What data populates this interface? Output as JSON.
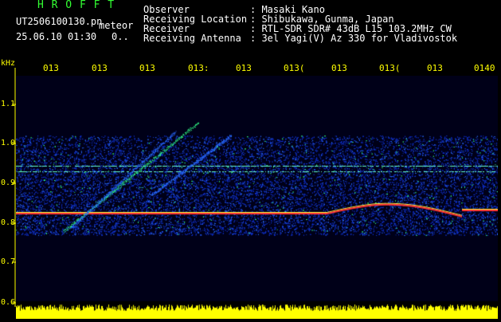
{
  "header": {
    "logo": "H R O F F T",
    "filename": "UT2506100130.pn",
    "type_label": "meteor",
    "datetime": "25.06.10 01:30",
    "extra": "0..",
    "fields": [
      {
        "label": "Observer",
        "value": ": Masaki Kano"
      },
      {
        "label": "Receiving Location",
        "value": ": Shibukawa, Gunma, Japan"
      },
      {
        "label": "Receiver",
        "value": ": RTL-SDR SDR# 43dB L15 103.2MHz CW"
      },
      {
        "label": "Receiving Antenna",
        "value": ": 3el Yagi(V) Az 330 for Vladivostok"
      }
    ]
  },
  "axis": {
    "unit": "kHz",
    "y_labels": [
      "1.1",
      "1.0",
      "0.9",
      "0.8",
      "0.7",
      "0.6"
    ],
    "x_labels": [
      "013",
      "013",
      "013",
      "013:",
      "013",
      "013(",
      "013",
      "013(",
      "013",
      "0140"
    ]
  },
  "colors": {
    "background": "#000000",
    "text": "#ffffff",
    "logo": "#33ff33",
    "axis_text": "#ffff00",
    "signal_noise": "#1a40ff",
    "signal_mid": "#33ff88",
    "signal_strong": "#ff3333",
    "level_bar": "#ffff00"
  }
}
